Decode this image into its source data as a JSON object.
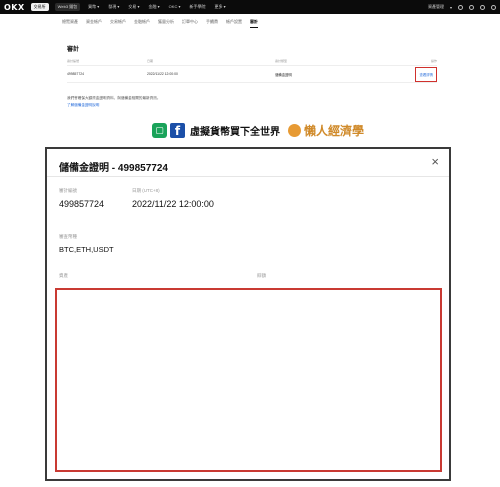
{
  "nav": {
    "logo": "OKX",
    "pills": [
      "交易所",
      "Web3 錢包"
    ],
    "items": [
      "買幣 ▾",
      "發現 ▾",
      "交易 ▾",
      "金融 ▾",
      "OKC ▾",
      "新手學院",
      "更多 ▾"
    ],
    "right": [
      "資產管理",
      "▾"
    ]
  },
  "subtabs": [
    "總覽資產",
    "資金帳戶",
    "交易帳戶",
    "金融帳戶",
    "獲量分析",
    "訂單中心",
    "手續費",
    "帳戶設置",
    "審計"
  ],
  "audit": {
    "title": "審計",
    "columns": [
      "審計編號",
      "日期",
      "審計類型",
      "操作"
    ],
    "row": {
      "id": "499857724",
      "date": "2022/11/22 12:00:00",
      "type": "儲備金證明",
      "action": "查看詳情"
    },
    "note": "我們會確保大額資金證明資料，與儲備金相關的最新資訊。",
    "note_link": "了解儲備金證明說明"
  },
  "banner": {
    "line_icon": "line-icon",
    "fb_icon": "facebook-icon",
    "text": "虛擬貨幣買下全世界",
    "brand": "懶人經濟學"
  },
  "modal": {
    "title": "儲備金證明 - 499857724",
    "close": "×",
    "audit_id_label": "審計編號",
    "audit_id": "499857724",
    "date_label": "日期 (UTC+8)",
    "date": "2022/11/22 12:00:00",
    "assets_label": "審查幣種",
    "assets": "BTC,ETH,USDT",
    "col_left": "資產",
    "col_right": "餘額"
  }
}
